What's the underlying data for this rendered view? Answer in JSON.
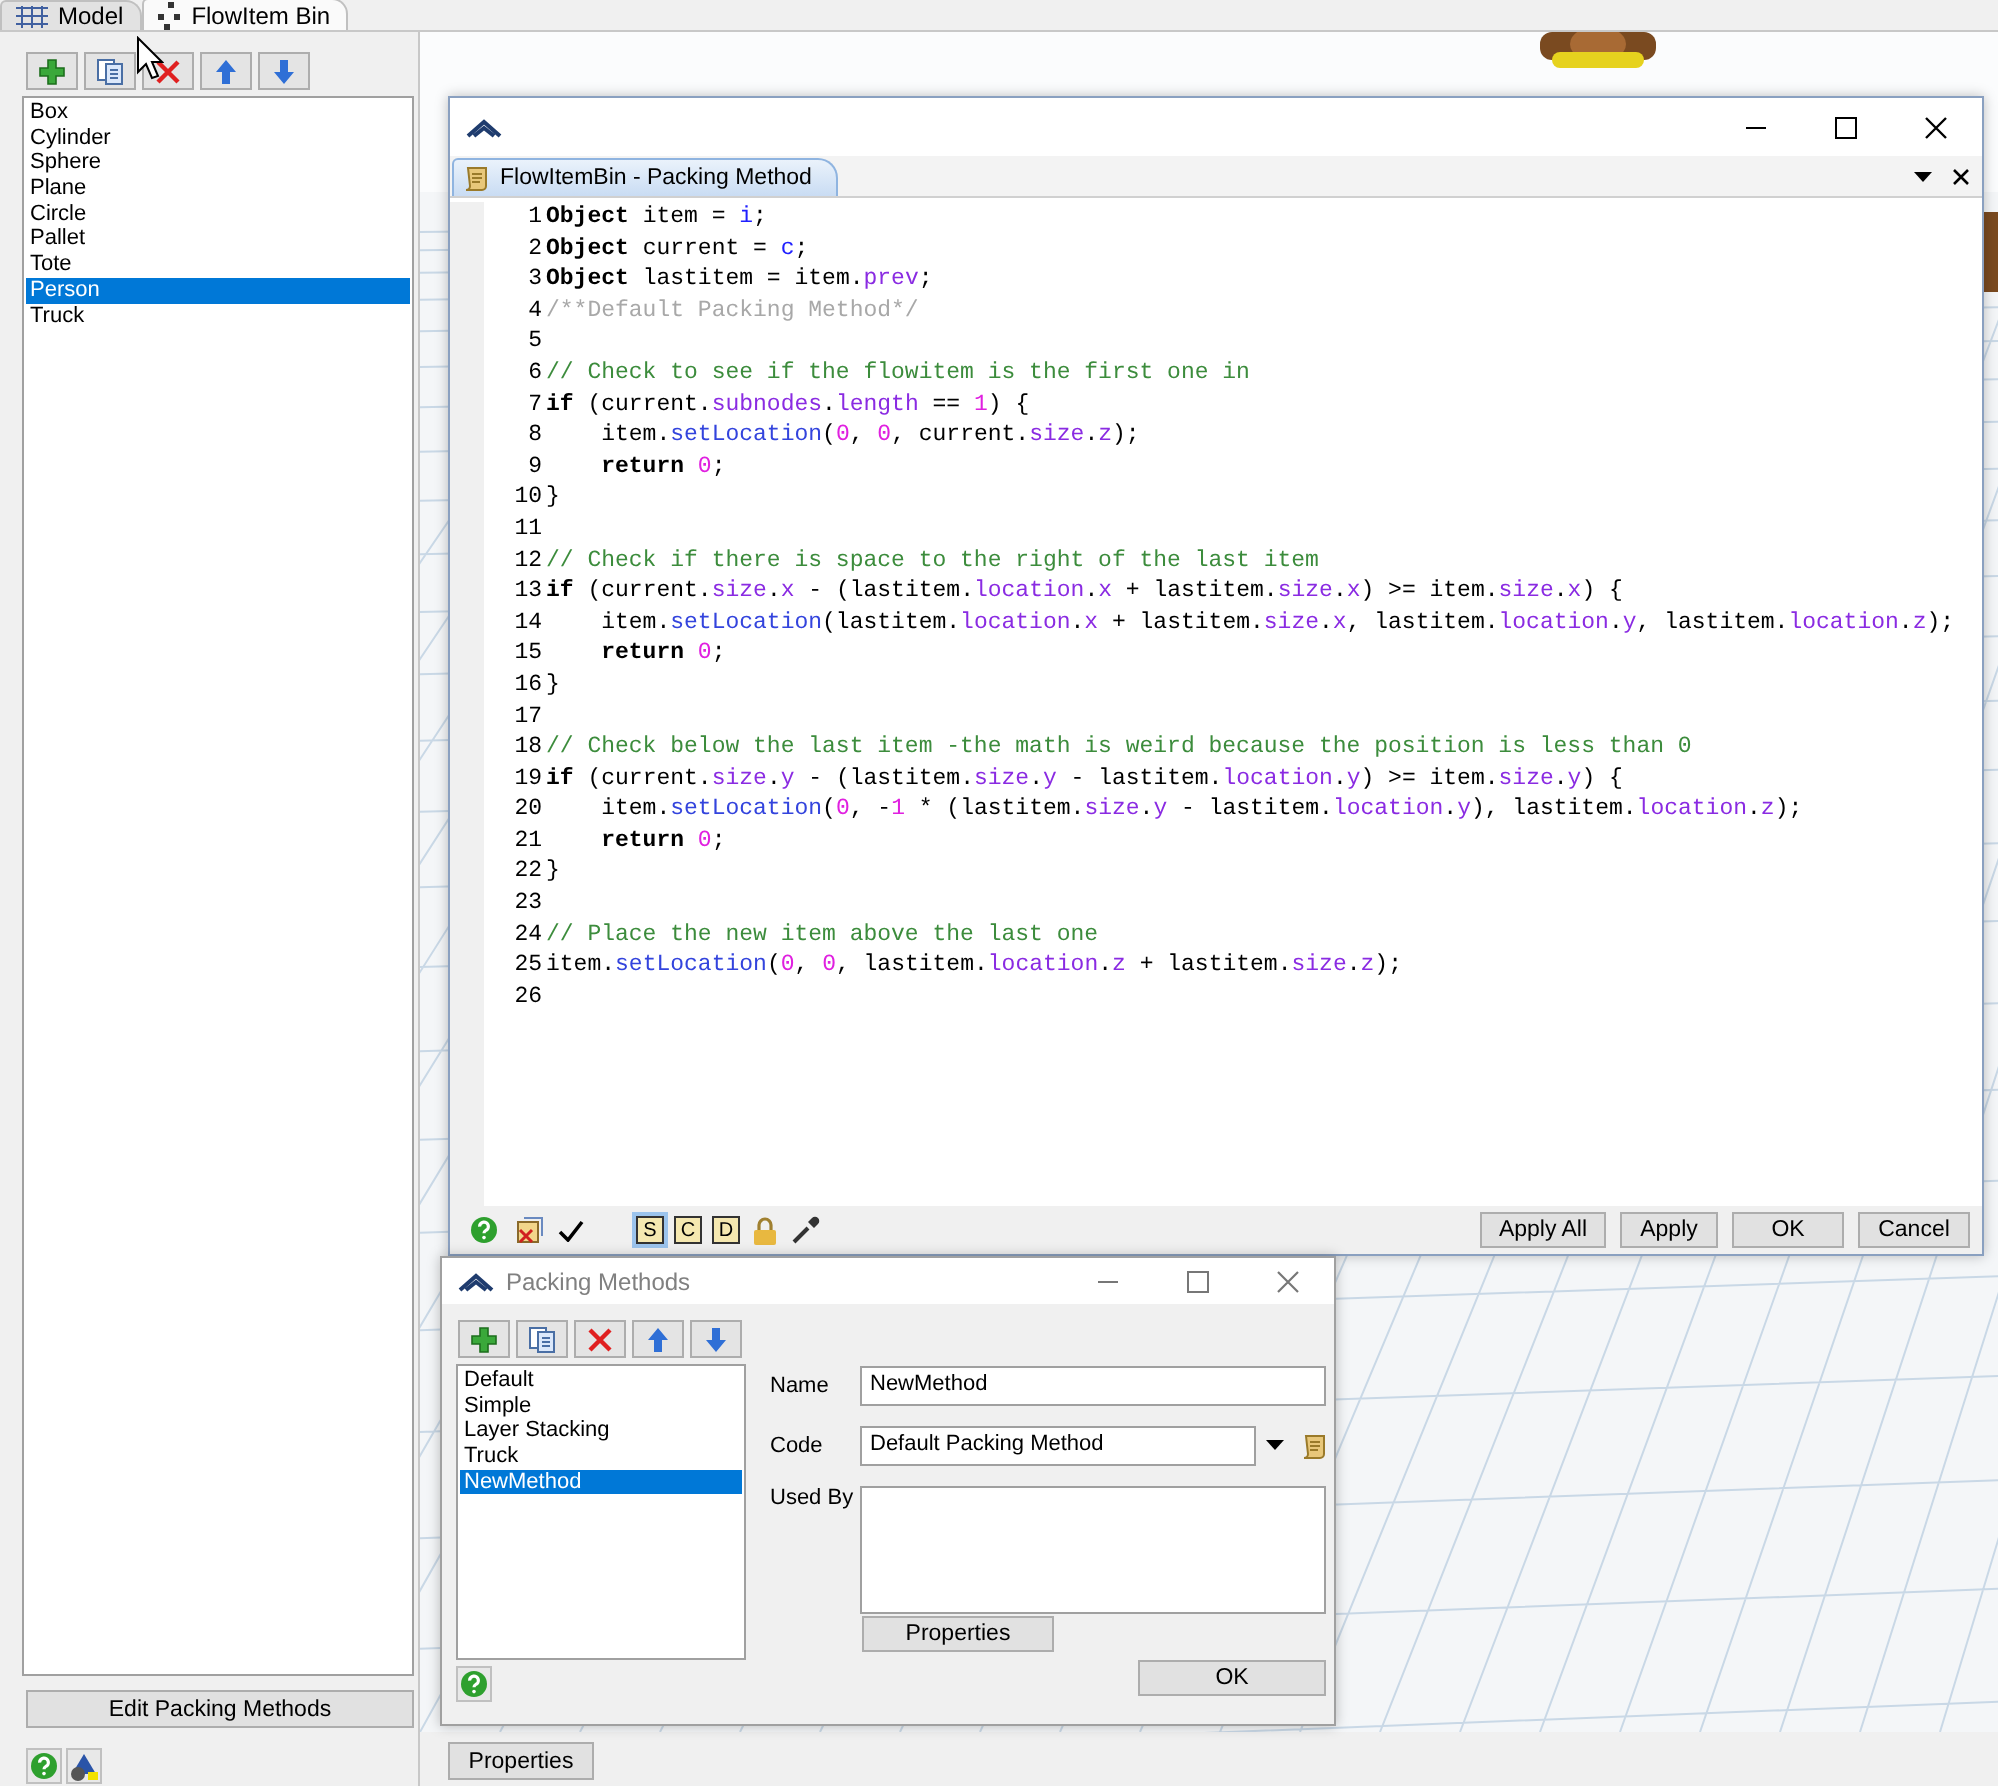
{
  "tabs": [
    {
      "label": "Model",
      "selected": false
    },
    {
      "label": "FlowItem Bin",
      "selected": true
    }
  ],
  "flowitems": [
    {
      "label": "Box",
      "selected": false
    },
    {
      "label": "Cylinder",
      "selected": false
    },
    {
      "label": "Sphere",
      "selected": false
    },
    {
      "label": "Plane",
      "selected": false
    },
    {
      "label": "Circle",
      "selected": false
    },
    {
      "label": "Pallet",
      "selected": false
    },
    {
      "label": "Tote",
      "selected": false
    },
    {
      "label": "Person",
      "selected": true
    },
    {
      "label": "Truck",
      "selected": false
    }
  ],
  "edit_button": "Edit Packing Methods",
  "properties_button": "Properties",
  "editor": {
    "tab": "FlowItemBin - Packing Method",
    "lines": [
      {
        "number": "1",
        "indent": false,
        "segments": [
          {
            "kind": "k",
            "text": "Object"
          },
          {
            "kind": "t",
            "text": " item = "
          },
          {
            "kind": "v",
            "text": "i"
          },
          {
            "kind": "t",
            "text": ";"
          }
        ]
      },
      {
        "number": "2",
        "indent": false,
        "segments": [
          {
            "kind": "k",
            "text": "Object"
          },
          {
            "kind": "t",
            "text": " current = "
          },
          {
            "kind": "v",
            "text": "c"
          },
          {
            "kind": "t",
            "text": ";"
          }
        ]
      },
      {
        "number": "3",
        "indent": false,
        "segments": [
          {
            "kind": "k",
            "text": "Object"
          },
          {
            "kind": "t",
            "text": " lastitem = item."
          },
          {
            "kind": "m",
            "text": "prev"
          },
          {
            "kind": "t",
            "text": ";"
          }
        ]
      },
      {
        "number": "4",
        "indent": false,
        "segments": [
          {
            "kind": "d",
            "text": "/**Default Packing Method*/"
          }
        ]
      },
      {
        "number": "5"
      },
      {
        "number": "6",
        "indent": false,
        "segments": [
          {
            "kind": "c",
            "text": "// Check to see if the flowitem is the first one in"
          }
        ]
      },
      {
        "number": "7",
        "indent": false,
        "segments": [
          {
            "kind": "k",
            "text": "if"
          },
          {
            "kind": "t",
            "text": " (current."
          },
          {
            "kind": "m",
            "text": "subnodes"
          },
          {
            "kind": "t",
            "text": "."
          },
          {
            "kind": "m",
            "text": "length"
          },
          {
            "kind": "t",
            "text": " == "
          },
          {
            "kind": "n",
            "text": "1"
          },
          {
            "kind": "t",
            "text": ") {"
          }
        ]
      },
      {
        "number": "8",
        "indent": true,
        "segments": [
          {
            "kind": "t",
            "text": "item."
          },
          {
            "kind": "f",
            "text": "setLocation"
          },
          {
            "kind": "t",
            "text": "("
          },
          {
            "kind": "n",
            "text": "0"
          },
          {
            "kind": "t",
            "text": ", "
          },
          {
            "kind": "n",
            "text": "0"
          },
          {
            "kind": "t",
            "text": ", current."
          },
          {
            "kind": "m",
            "text": "size"
          },
          {
            "kind": "t",
            "text": "."
          },
          {
            "kind": "m",
            "text": "z"
          },
          {
            "kind": "t",
            "text": ");"
          }
        ]
      },
      {
        "number": "9",
        "indent": true,
        "segments": [
          {
            "kind": "k",
            "text": "return "
          },
          {
            "kind": "n",
            "text": "0"
          },
          {
            "kind": "t",
            "text": ";"
          }
        ]
      },
      {
        "number": "10",
        "indent": false,
        "segments": [
          {
            "kind": "t",
            "text": "}"
          }
        ]
      },
      {
        "number": "11"
      },
      {
        "number": "12",
        "indent": false,
        "segments": [
          {
            "kind": "c",
            "text": "// Check if there is space to the right of the last item"
          }
        ]
      },
      {
        "number": "13",
        "indent": false,
        "segments": [
          {
            "kind": "k",
            "text": "if"
          },
          {
            "kind": "t",
            "text": " (current."
          },
          {
            "kind": "m",
            "text": "size"
          },
          {
            "kind": "t",
            "text": "."
          },
          {
            "kind": "m",
            "text": "x"
          },
          {
            "kind": "t",
            "text": " - (lastitem."
          },
          {
            "kind": "m",
            "text": "location"
          },
          {
            "kind": "t",
            "text": "."
          },
          {
            "kind": "m",
            "text": "x"
          },
          {
            "kind": "t",
            "text": " + lastitem."
          },
          {
            "kind": "m",
            "text": "size"
          },
          {
            "kind": "t",
            "text": "."
          },
          {
            "kind": "m",
            "text": "x"
          },
          {
            "kind": "t",
            "text": ") >= item."
          },
          {
            "kind": "m",
            "text": "size"
          },
          {
            "kind": "t",
            "text": "."
          },
          {
            "kind": "m",
            "text": "x"
          },
          {
            "kind": "t",
            "text": ") {"
          }
        ]
      },
      {
        "number": "14",
        "indent": true,
        "segments": [
          {
            "kind": "t",
            "text": "item."
          },
          {
            "kind": "f",
            "text": "setLocation"
          },
          {
            "kind": "t",
            "text": "(lastitem."
          },
          {
            "kind": "m",
            "text": "location"
          },
          {
            "kind": "t",
            "text": "."
          },
          {
            "kind": "m",
            "text": "x"
          },
          {
            "kind": "t",
            "text": " + lastitem."
          },
          {
            "kind": "m",
            "text": "size"
          },
          {
            "kind": "t",
            "text": "."
          },
          {
            "kind": "m",
            "text": "x"
          },
          {
            "kind": "t",
            "text": ", lastitem."
          },
          {
            "kind": "m",
            "text": "location"
          },
          {
            "kind": "t",
            "text": "."
          },
          {
            "kind": "m",
            "text": "y"
          },
          {
            "kind": "t",
            "text": ", lastitem."
          },
          {
            "kind": "m",
            "text": "location"
          },
          {
            "kind": "t",
            "text": "."
          },
          {
            "kind": "m",
            "text": "z"
          },
          {
            "kind": "t",
            "text": ");"
          }
        ]
      },
      {
        "number": "15",
        "indent": true,
        "segments": [
          {
            "kind": "k",
            "text": "return "
          },
          {
            "kind": "n",
            "text": "0"
          },
          {
            "kind": "t",
            "text": ";"
          }
        ]
      },
      {
        "number": "16",
        "indent": false,
        "segments": [
          {
            "kind": "t",
            "text": "}"
          }
        ]
      },
      {
        "number": "17"
      },
      {
        "number": "18",
        "indent": false,
        "segments": [
          {
            "kind": "c",
            "text": "// Check below the last item -the math is weird because the position is less than 0"
          }
        ]
      },
      {
        "number": "19",
        "indent": false,
        "segments": [
          {
            "kind": "k",
            "text": "if"
          },
          {
            "kind": "t",
            "text": " (current."
          },
          {
            "kind": "m",
            "text": "size"
          },
          {
            "kind": "t",
            "text": "."
          },
          {
            "kind": "m",
            "text": "y"
          },
          {
            "kind": "t",
            "text": " - (lastitem."
          },
          {
            "kind": "m",
            "text": "size"
          },
          {
            "kind": "t",
            "text": "."
          },
          {
            "kind": "m",
            "text": "y"
          },
          {
            "kind": "t",
            "text": " - lastitem."
          },
          {
            "kind": "m",
            "text": "location"
          },
          {
            "kind": "t",
            "text": "."
          },
          {
            "kind": "m",
            "text": "y"
          },
          {
            "kind": "t",
            "text": ") >= item."
          },
          {
            "kind": "m",
            "text": "size"
          },
          {
            "kind": "t",
            "text": "."
          },
          {
            "kind": "m",
            "text": "y"
          },
          {
            "kind": "t",
            "text": ") {"
          }
        ]
      },
      {
        "number": "20",
        "indent": true,
        "segments": [
          {
            "kind": "t",
            "text": "item."
          },
          {
            "kind": "f",
            "text": "setLocation"
          },
          {
            "kind": "t",
            "text": "("
          },
          {
            "kind": "n",
            "text": "0"
          },
          {
            "kind": "t",
            "text": ", -"
          },
          {
            "kind": "n",
            "text": "1"
          },
          {
            "kind": "t",
            "text": " * (lastitem."
          },
          {
            "kind": "m",
            "text": "size"
          },
          {
            "kind": "t",
            "text": "."
          },
          {
            "kind": "m",
            "text": "y"
          },
          {
            "kind": "t",
            "text": " - lastitem."
          },
          {
            "kind": "m",
            "text": "location"
          },
          {
            "kind": "t",
            "text": "."
          },
          {
            "kind": "m",
            "text": "y"
          },
          {
            "kind": "t",
            "text": "), lastitem."
          },
          {
            "kind": "m",
            "text": "location"
          },
          {
            "kind": "t",
            "text": "."
          },
          {
            "kind": "m",
            "text": "z"
          },
          {
            "kind": "t",
            "text": ");"
          }
        ]
      },
      {
        "number": "21",
        "indent": true,
        "segments": [
          {
            "kind": "k",
            "text": "return "
          },
          {
            "kind": "n",
            "text": "0"
          },
          {
            "kind": "t",
            "text": ";"
          }
        ]
      },
      {
        "number": "22",
        "indent": false,
        "segments": [
          {
            "kind": "t",
            "text": "}"
          }
        ]
      },
      {
        "number": "23"
      },
      {
        "number": "24",
        "indent": false,
        "segments": [
          {
            "kind": "c",
            "text": "// Place the new item above the last one"
          }
        ]
      },
      {
        "number": "25",
        "indent": false,
        "segments": [
          {
            "kind": "t",
            "text": "item."
          },
          {
            "kind": "f",
            "text": "setLocation"
          },
          {
            "kind": "t",
            "text": "("
          },
          {
            "kind": "n",
            "text": "0"
          },
          {
            "kind": "t",
            "text": ", "
          },
          {
            "kind": "n",
            "text": "0"
          },
          {
            "kind": "t",
            "text": ", lastitem."
          },
          {
            "kind": "m",
            "text": "location"
          },
          {
            "kind": "t",
            "text": "."
          },
          {
            "kind": "m",
            "text": "z"
          },
          {
            "kind": "t",
            "text": " + lastitem."
          },
          {
            "kind": "m",
            "text": "size"
          },
          {
            "kind": "t",
            "text": "."
          },
          {
            "kind": "m",
            "text": "z"
          },
          {
            "kind": "t",
            "text": ");"
          }
        ]
      },
      {
        "number": "26"
      }
    ],
    "toggles": [
      {
        "label": "S",
        "selected": true
      },
      {
        "label": "C",
        "selected": false
      },
      {
        "label": "D",
        "selected": false
      }
    ],
    "buttons": [
      "Apply All",
      "Apply",
      "OK",
      "Cancel"
    ]
  },
  "packing_window": {
    "title": "Packing Methods",
    "methods": [
      {
        "label": "Default",
        "selected": false
      },
      {
        "label": "Simple",
        "selected": false
      },
      {
        "label": "Layer Stacking",
        "selected": false
      },
      {
        "label": "Truck",
        "selected": false
      },
      {
        "label": "NewMethod",
        "selected": true
      }
    ],
    "name_label": "Name",
    "name_value": "NewMethod",
    "code_label": "Code",
    "code_value": "Default Packing Method",
    "used_by_label": "Used By",
    "properties_button": "Properties",
    "ok_button": "OK"
  }
}
